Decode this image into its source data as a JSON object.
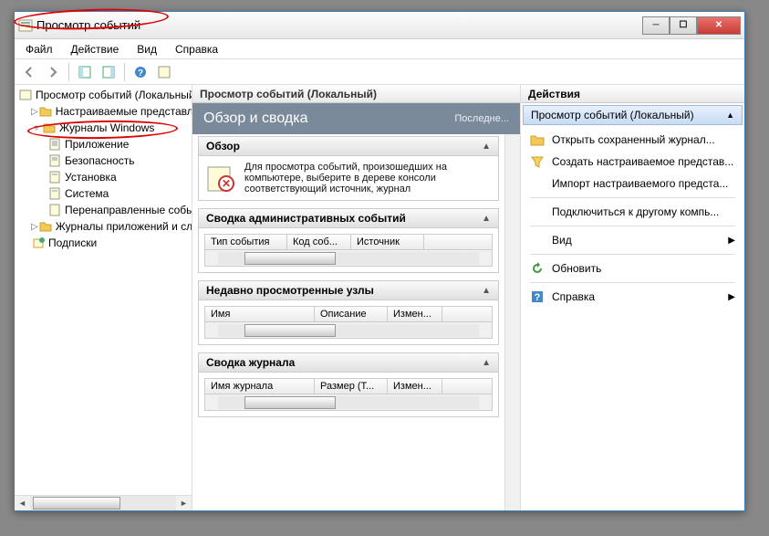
{
  "title": "Просмотр событий",
  "menubar": {
    "file": "Файл",
    "action": "Действие",
    "view": "Вид",
    "help": "Справка"
  },
  "tree": {
    "root": "Просмотр событий (Локальный)",
    "custom_views": "Настраиваемые представления",
    "win_logs": "Журналы Windows",
    "app": "Приложение",
    "security": "Безопасность",
    "setup": "Установка",
    "system": "Система",
    "forwarded": "Перенаправленные события",
    "app_service": "Журналы приложений и служб",
    "subs": "Подписки"
  },
  "mid": {
    "header": "Просмотр событий (Локальный)",
    "banner_title": "Обзор и сводка",
    "banner_sub": "Последне...",
    "s_overview": "Обзор",
    "overview_text": "Для просмотра событий, произошедших на компьютере, выберите в дереве консоли соответствующий источник, журнал",
    "s_admin": "Сводка административных событий",
    "admin_cols": {
      "c1": "Тип события",
      "c2": "Код соб...",
      "c3": "Источник"
    },
    "s_recent": "Недавно просмотренные узлы",
    "recent_cols": {
      "c1": "Имя",
      "c2": "Описание",
      "c3": "Измен..."
    },
    "s_logsum": "Сводка журнала",
    "logsum_cols": {
      "c1": "Имя журнала",
      "c2": "Размер (Т...",
      "c3": "Измен..."
    }
  },
  "right": {
    "header": "Действия",
    "group": "Просмотр событий (Локальный)",
    "open_saved": "Открыть сохраненный журнал...",
    "create_custom": "Создать настраиваемое представ...",
    "import_custom": "Импорт настраиваемого предста...",
    "connect": "Подключиться к другому компь...",
    "view": "Вид",
    "refresh": "Обновить",
    "help": "Справка"
  }
}
